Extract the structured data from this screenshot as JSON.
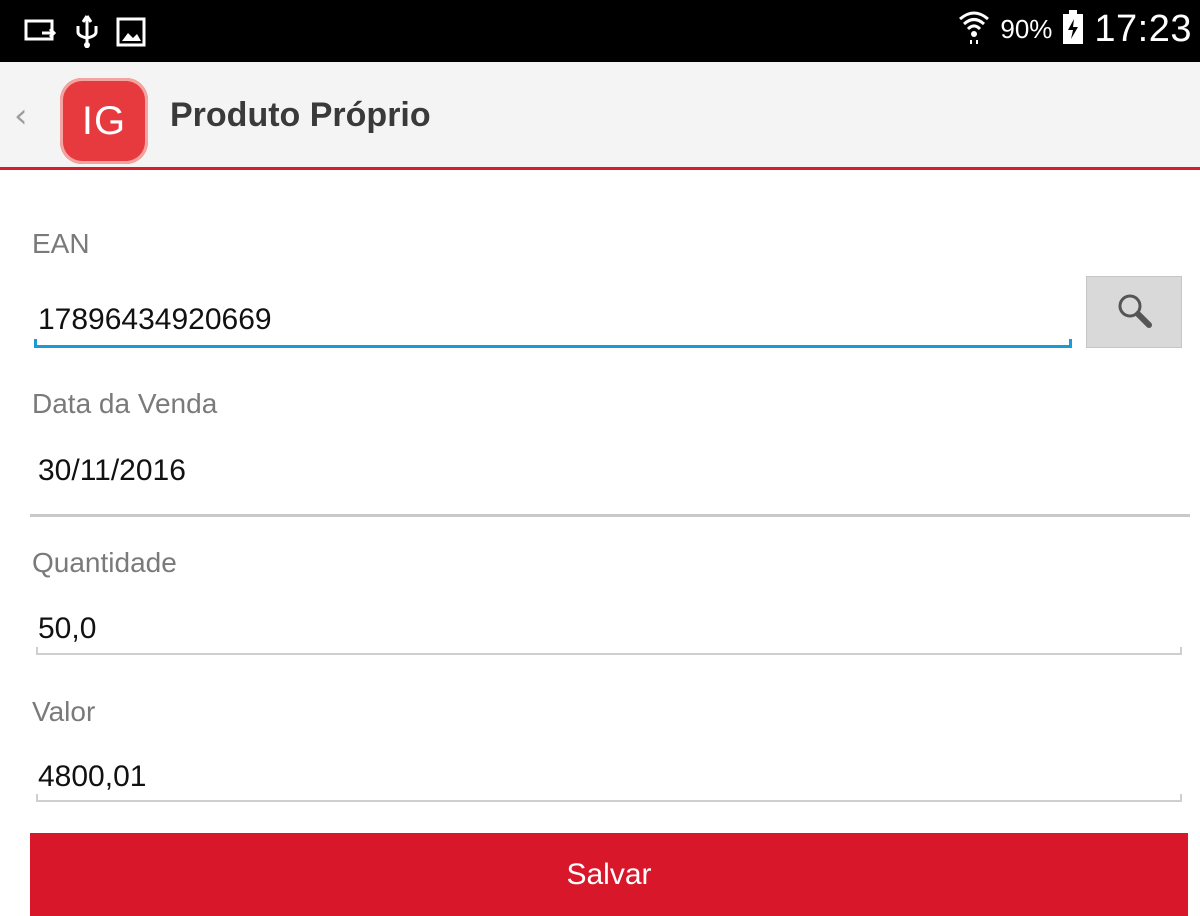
{
  "statusbar": {
    "battery_text": "90%",
    "time": "17:23",
    "icons": [
      "cast-icon",
      "usb-icon",
      "image-icon",
      "wifi-icon",
      "battery-charging-icon"
    ]
  },
  "actionbar": {
    "back_glyph": "‹",
    "logo_text": "IG",
    "title": "Produto Próprio"
  },
  "form": {
    "ean": {
      "label": "EAN",
      "value": "17896434920669"
    },
    "data_venda": {
      "label": "Data da Venda",
      "value": "30/11/2016"
    },
    "quantidade": {
      "label": "Quantidade",
      "value": "50,0"
    },
    "valor": {
      "label": "Valor",
      "value": "4800,01"
    }
  },
  "save_button_label": "Salvar",
  "colors": {
    "accent": "#d8172a",
    "focus_underline": "#1a9bd7",
    "logo": "#e73a3f",
    "actionbar_bg": "#f4f4f4"
  }
}
